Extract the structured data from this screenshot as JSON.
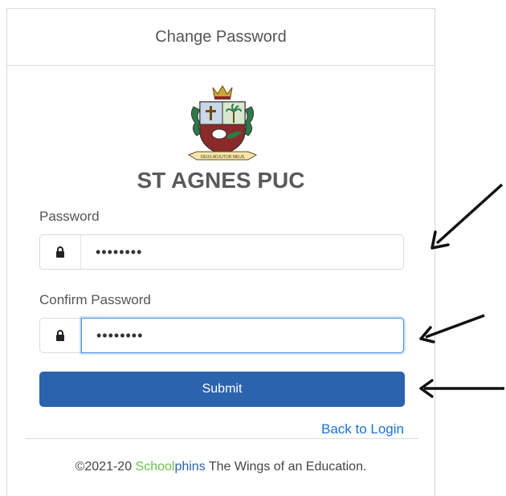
{
  "header": {
    "title": "Change Password"
  },
  "org": {
    "name": "ST AGNES PUC",
    "logo_icon": "school-crest-icon",
    "logo_motto": "DEUS ADJUTOR MEUS"
  },
  "form": {
    "password_label": "Password",
    "password_value": "••••••••",
    "confirm_label": "Confirm Password",
    "confirm_value": "••••••••",
    "submit_label": "Submit",
    "lock_icon": "lock-icon"
  },
  "links": {
    "back_to_login": "Back to Login"
  },
  "footer": {
    "prefix": "©2021-20 ",
    "brand_part1": "School",
    "brand_part2": "phins",
    "suffix": " The Wings of an Education."
  },
  "colors": {
    "primary": "#2b63ad",
    "link": "#1a73d9",
    "brand_green": "#6cc04a"
  }
}
